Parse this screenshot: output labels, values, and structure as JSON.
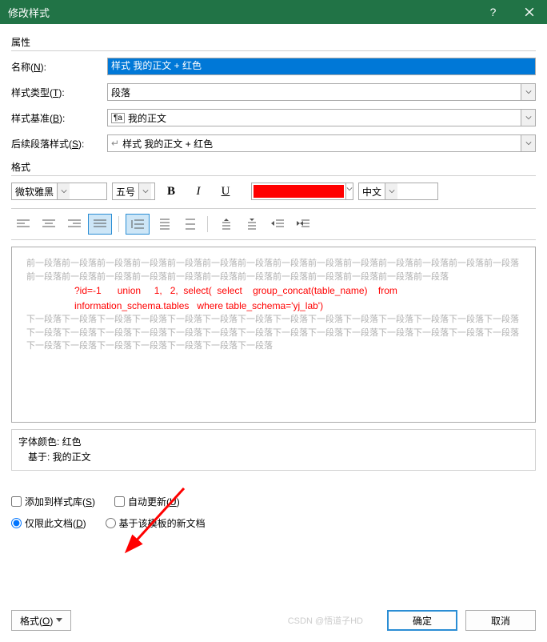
{
  "titlebar": {
    "title": "修改样式"
  },
  "sections": {
    "properties": "属性",
    "format": "格式"
  },
  "labels": {
    "name": "名称(",
    "name_key": "N",
    "name_suffix": "):",
    "style_type": "样式类型(",
    "style_type_key": "T",
    "style_type_suffix": "):",
    "style_base": "样式基准(",
    "style_base_key": "B",
    "style_base_suffix": "):",
    "next_style": "后续段落样式(",
    "next_style_key": "S",
    "next_style_suffix": "):"
  },
  "values": {
    "name": "样式 我的正文 + 红色",
    "style_type": "段落",
    "style_base": "我的正文",
    "next_style": "样式 我的正文 + 红色",
    "font_name": "微软雅黑",
    "font_size": "五号",
    "language": "中文",
    "color": "#ff0000"
  },
  "fmt_btns": {
    "bold": "B",
    "italic": "I",
    "underline": "U"
  },
  "preview": {
    "before": "前一段落前一段落前一段落前一段落前一段落前一段落前一段落前一段落前一段落前一段落前一段落前一段落前一段落前一段落前一段落前一段落前一段落前一段落前一段落前一段落前一段落前一段落前一段落前一段落前一段落前一段落",
    "red_text": "?id=-1      union     1,   2,  select(  select    group_concat(table_name)    from information_schema.tables   where table_schema='yj_lab')",
    "after": "下一段落下一段落下一段落下一段落下一段落下一段落下一段落下一段落下一段落下一段落下一段落下一段落下一段落下一段落下一段落下一段落下一段落下一段落下一段落下一段落下一段落下一段落下一段落下一段落下一段落下一段落下一段落下一段落下一段落下一段落下一段落下一段落下一段落下一段落下一段落"
  },
  "desc": {
    "line1": "字体颜色: 红色",
    "line2": "基于: 我的正文"
  },
  "options": {
    "add_to_lib": "添加到样式库(",
    "add_to_lib_key": "S",
    "add_to_lib_suffix": ")",
    "auto_update": "自动更新(",
    "auto_update_key": "U",
    "auto_update_suffix": ")",
    "only_doc": "仅限此文档(",
    "only_doc_key": "D",
    "only_doc_suffix": ")",
    "template_new": "基于该模板的新文档"
  },
  "footer": {
    "format_btn": "格式(",
    "format_btn_key": "O",
    "format_btn_suffix": ")",
    "ok": "确定",
    "cancel": "取消"
  },
  "watermark": "CSDN @悟道子HD"
}
